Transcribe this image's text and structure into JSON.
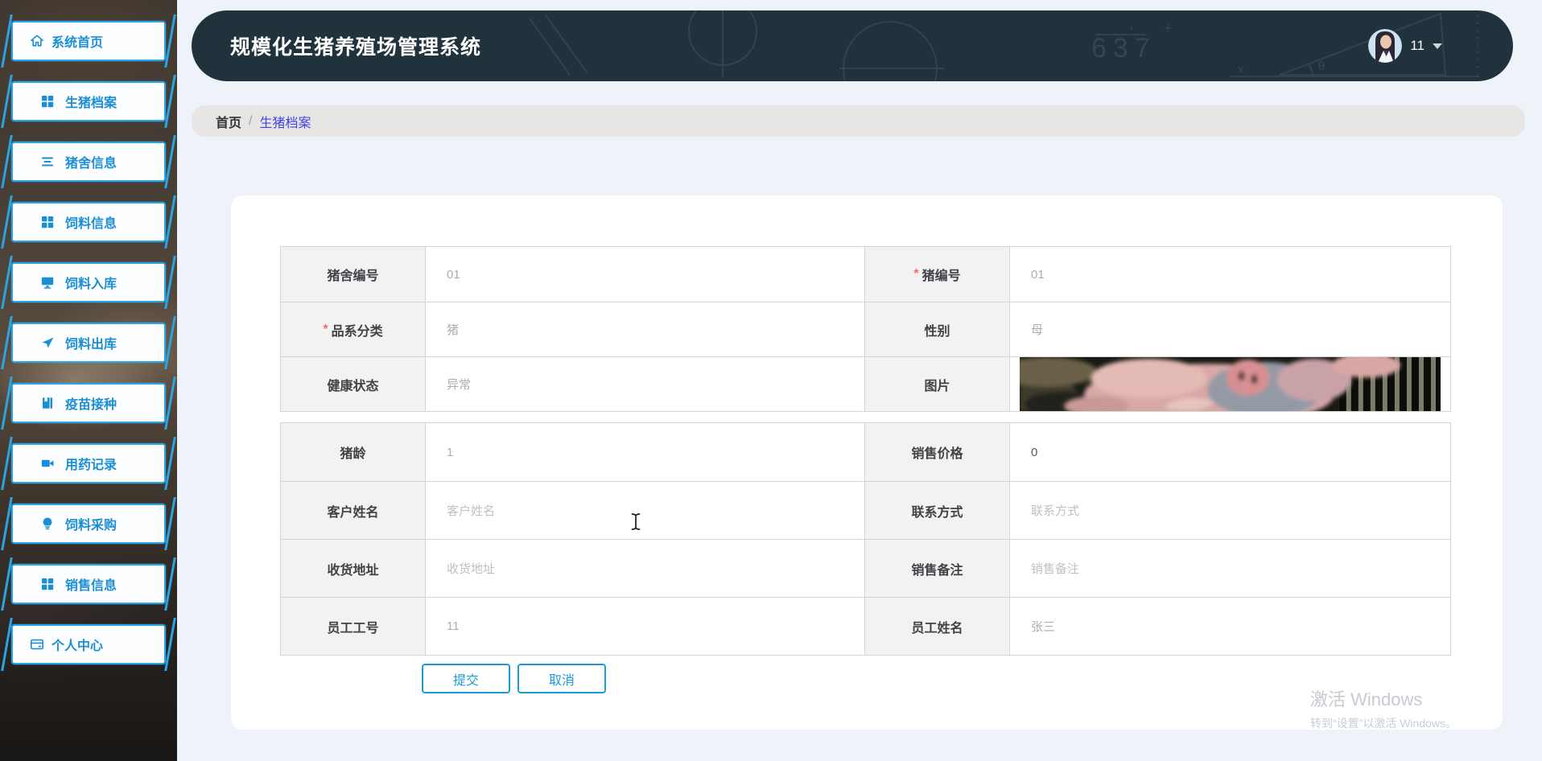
{
  "app": {
    "title": "规模化生猪养殖场管理系统",
    "user": {
      "name": "11"
    },
    "accent_blue": "#2aa5e3",
    "header_bg": "#20333d",
    "breadcrumb_link_color": "#3d44e0"
  },
  "sidebar": {
    "items": [
      {
        "id": "home",
        "icon": "home-icon",
        "label": "系统首页"
      },
      {
        "id": "pig-archive",
        "icon": "grid-icon",
        "label": "生猪档案"
      },
      {
        "id": "pigsty-info",
        "icon": "list-icon",
        "label": "猪舍信息"
      },
      {
        "id": "feed-info",
        "icon": "grid-icon",
        "label": "饲料信息"
      },
      {
        "id": "feed-inbound",
        "icon": "monitor-icon",
        "label": "饲料入库"
      },
      {
        "id": "feed-outbound",
        "icon": "send-icon",
        "label": "饲料出库"
      },
      {
        "id": "vaccine",
        "icon": "notebook-icon",
        "label": "疫苗接种"
      },
      {
        "id": "medication",
        "icon": "video-icon",
        "label": "用药记录"
      },
      {
        "id": "feed-purchase",
        "icon": "lightbulb-icon",
        "label": "饲料采购"
      },
      {
        "id": "sales-info",
        "icon": "grid-icon",
        "label": "销售信息"
      },
      {
        "id": "profile",
        "icon": "bank-card-icon",
        "label": "个人中心"
      }
    ]
  },
  "breadcrumb": {
    "home": "首页",
    "separator": "/",
    "current": "生猪档案"
  },
  "form": {
    "group1": [
      {
        "left": {
          "label": "猪舍编号",
          "required": false,
          "value": "01",
          "tone": "muted"
        },
        "right": {
          "label": "猪编号",
          "required": true,
          "value": "01",
          "tone": "muted"
        }
      },
      {
        "left": {
          "label": "品系分类",
          "required": true,
          "value": "猪",
          "tone": "muted"
        },
        "right": {
          "label": "性别",
          "required": false,
          "value": "母",
          "tone": "muted"
        }
      },
      {
        "left": {
          "label": "健康状态",
          "required": false,
          "value": "异常",
          "tone": "muted"
        },
        "right": {
          "label": "图片",
          "required": false,
          "value": "",
          "type": "image",
          "image_alt": "pig-photo"
        }
      }
    ],
    "group2": [
      {
        "left": {
          "label": "猪龄",
          "value": "1",
          "tone": "muted"
        },
        "right": {
          "label": "销售价格",
          "value": "0",
          "tone": "dark"
        }
      },
      {
        "left": {
          "label": "客户姓名",
          "value": "客户姓名",
          "tone": "placeholder"
        },
        "right": {
          "label": "联系方式",
          "value": "联系方式",
          "tone": "placeholder"
        }
      },
      {
        "left": {
          "label": "收货地址",
          "value": "收货地址",
          "tone": "placeholder"
        },
        "right": {
          "label": "销售备注",
          "value": "销售备注",
          "tone": "placeholder"
        }
      },
      {
        "left": {
          "label": "员工工号",
          "value": "11",
          "tone": "muted"
        },
        "right": {
          "label": "员工姓名",
          "value": "张三",
          "tone": "muted"
        }
      }
    ],
    "submit_label": "提交",
    "cancel_label": "取消"
  },
  "watermark": {
    "line1": "激活 Windows",
    "line2": "转到“设置”以激活 Windows。"
  }
}
